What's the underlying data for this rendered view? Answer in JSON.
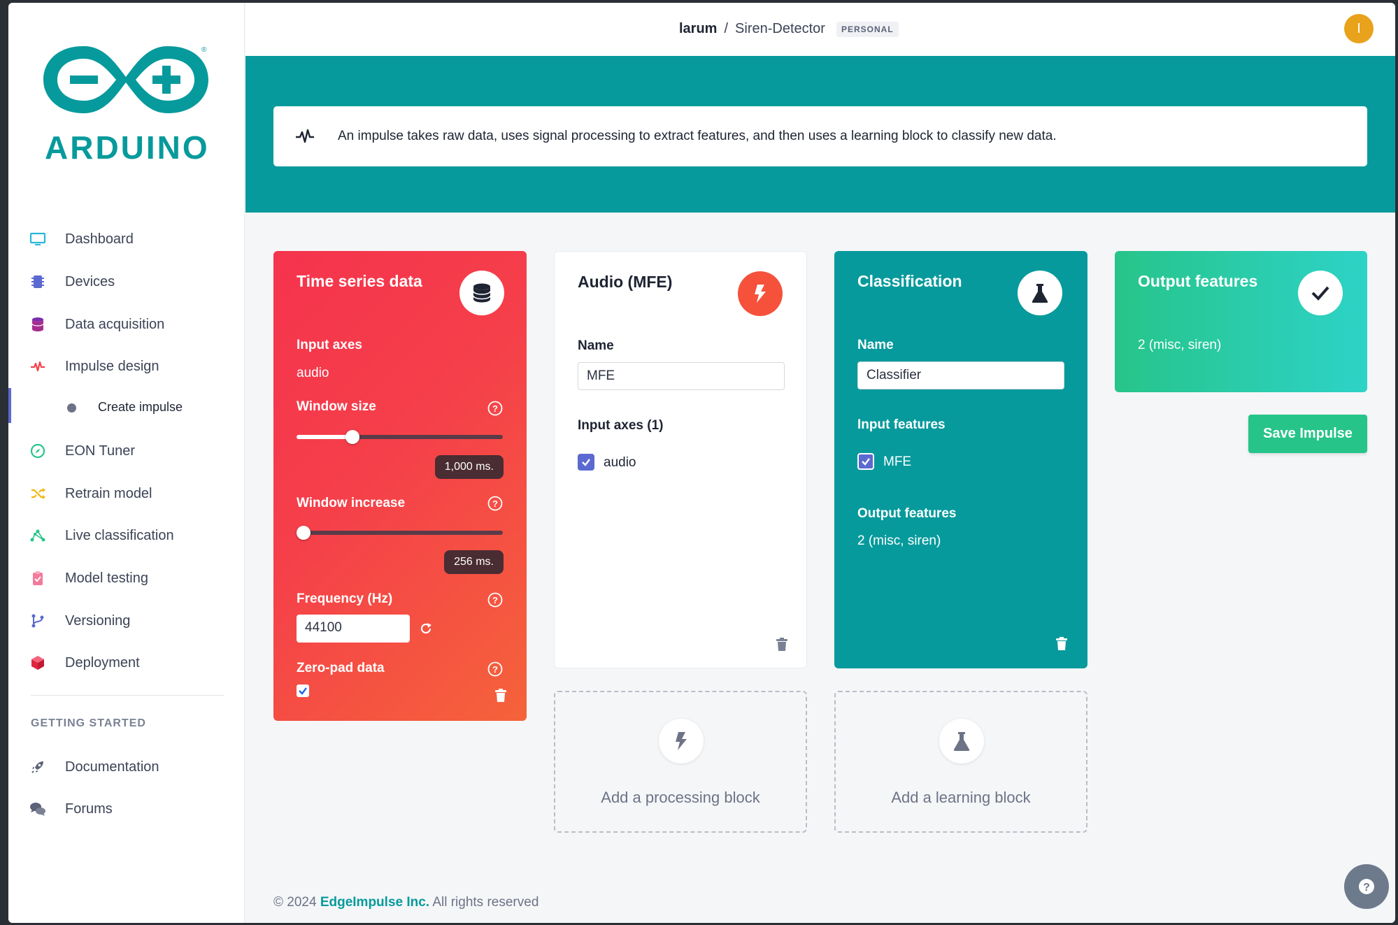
{
  "brand": {
    "logo_text": "ARDUINO"
  },
  "sidebar": {
    "items": [
      {
        "label": "Dashboard",
        "icon": "monitor-icon"
      },
      {
        "label": "Devices",
        "icon": "chip-icon"
      },
      {
        "label": "Data acquisition",
        "icon": "database-icon"
      },
      {
        "label": "Impulse design",
        "icon": "pulse-icon"
      },
      {
        "label": "EON Tuner",
        "icon": "compass-icon"
      },
      {
        "label": "Retrain model",
        "icon": "shuffle-icon"
      },
      {
        "label": "Live classification",
        "icon": "network-icon"
      },
      {
        "label": "Model testing",
        "icon": "clipboard-icon"
      },
      {
        "label": "Versioning",
        "icon": "branch-icon"
      },
      {
        "label": "Deployment",
        "icon": "cube-icon"
      }
    ],
    "sub_item": "Create impulse",
    "section_header": "GETTING STARTED",
    "links": [
      {
        "label": "Documentation",
        "icon": "rocket-icon"
      },
      {
        "label": "Forums",
        "icon": "chat-icon"
      }
    ]
  },
  "header": {
    "user": "larum",
    "separator": "/",
    "project": "Siren-Detector",
    "badge": "PERSONAL",
    "avatar_initial": "I"
  },
  "info": {
    "text": "An impulse takes raw data, uses signal processing to extract features, and then uses a learning block to classify new data."
  },
  "ts_card": {
    "title": "Time series data",
    "input_axes_label": "Input axes",
    "input_axes_value": "audio",
    "window_size_label": "Window size",
    "window_size_value": "1,000 ms.",
    "window_size_fraction": 0.27,
    "window_increase_label": "Window increase",
    "window_increase_value": "256 ms.",
    "window_increase_fraction": 0.03,
    "frequency_label": "Frequency (Hz)",
    "frequency_value": "44100",
    "zero_pad_label": "Zero-pad data",
    "zero_pad_checked": true
  },
  "mfe_card": {
    "title": "Audio (MFE)",
    "name_label": "Name",
    "name_value": "MFE",
    "input_axes_label": "Input axes (1)",
    "input_axes_item": "audio"
  },
  "cls_card": {
    "title": "Classification",
    "name_label": "Name",
    "name_value": "Classifier",
    "input_features_label": "Input features",
    "input_features_item": "MFE",
    "output_features_label": "Output features",
    "output_features_value": "2 (misc, siren)"
  },
  "out_card": {
    "title": "Output features",
    "value": "2 (misc, siren)"
  },
  "save_button": "Save Impulse",
  "add_processing": "Add a processing block",
  "add_learning": "Add a learning block",
  "footer": {
    "prefix": "© 2024",
    "company": "EdgeImpulse Inc.",
    "suffix": "All rights reserved"
  },
  "colors": {
    "teal": "#079a9c",
    "coral": "#f5404a",
    "green": "#27c48a",
    "accent": "#5b6ad0"
  }
}
